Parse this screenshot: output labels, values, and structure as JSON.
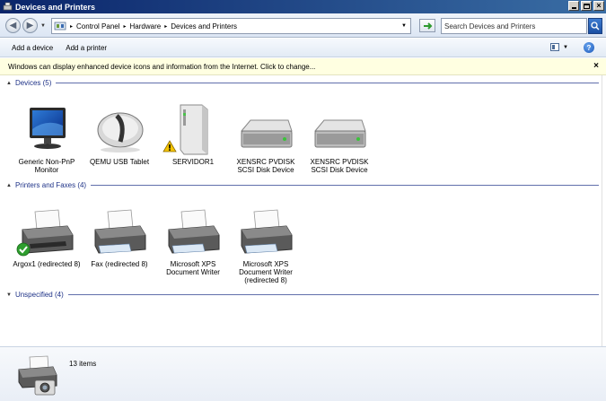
{
  "window": {
    "title": "Devices and Printers",
    "controls": {
      "minimize": "_",
      "maximize": "□",
      "close": "×"
    }
  },
  "address": {
    "crumbs": [
      "Control Panel",
      "Hardware",
      "Devices and Printers"
    ],
    "search_placeholder": "Search Devices and Printers"
  },
  "commands": {
    "add_device": "Add a device",
    "add_printer": "Add a printer"
  },
  "infobar": {
    "message": "Windows can display enhanced device icons and information from the Internet. Click to change...",
    "close": "×"
  },
  "groups": {
    "devices": {
      "header": "Devices (5)",
      "items": [
        {
          "label": "Generic Non-PnP Monitor",
          "icon": "monitor-icon"
        },
        {
          "label": "QEMU USB Tablet",
          "icon": "mouse-icon"
        },
        {
          "label": "SERVIDOR1",
          "icon": "computer-tower-icon",
          "badge": "warning"
        },
        {
          "label": "XENSRC PVDISK SCSI Disk Device",
          "icon": "hard-drive-icon"
        },
        {
          "label": "XENSRC PVDISK SCSI Disk Device",
          "icon": "hard-drive-icon"
        }
      ]
    },
    "printers": {
      "header": "Printers and Faxes (4)",
      "items": [
        {
          "label": "Argox1 (redirected 8)",
          "icon": "printer-icon",
          "badge": "default-check"
        },
        {
          "label": "Fax (redirected 8)",
          "icon": "printer-icon"
        },
        {
          "label": "Microsoft XPS Document Writer",
          "icon": "printer-icon"
        },
        {
          "label": "Microsoft XPS Document Writer (redirected 8)",
          "icon": "printer-icon"
        }
      ]
    },
    "unspecified": {
      "header": "Unspecified (4)"
    }
  },
  "details": {
    "count": "13 items"
  },
  "colors": {
    "title_bar": "#0a246a",
    "group_header": "#1e3287",
    "infobar_bg": "#ffffe1",
    "check_green": "#2e9e2e",
    "warning_yellow": "#f5c400"
  }
}
